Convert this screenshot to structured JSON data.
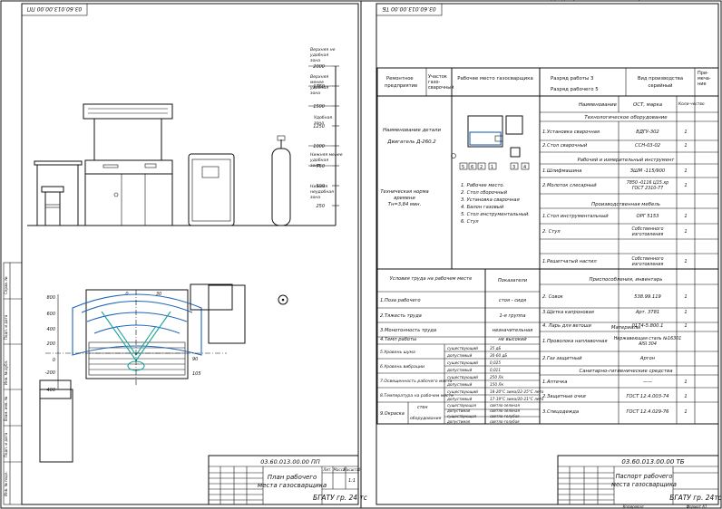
{
  "sheet_left": {
    "rotated_code": "03.60.013.00.00 ПП",
    "height_labels": [
      "2000",
      "1750",
      "1500",
      "1250",
      "1000",
      "750",
      "500",
      "250"
    ],
    "zones": [
      "Верхняя не удобная зона",
      "Верхняя менее удобная зона",
      "Удобная зона",
      "Нижняя менее удобная зона",
      "Нижняя неудобная зона"
    ],
    "plan_axis": [
      "800",
      "600",
      "400",
      "200",
      "0",
      "-200",
      "400"
    ],
    "plan_top": [
      "0",
      "30"
    ],
    "plan_right": [
      "90",
      "105"
    ],
    "title_code": "03.60.013.00.00 ПП",
    "title_name": "План рабочего места газосварщика",
    "title_org": "БГАТУ гр. 24 тс",
    "scale_hdr": [
      "Лит.",
      "Масса",
      "Масштаб"
    ],
    "scale_val": "1:1",
    "side_stamp": [
      "Инв. № подл.",
      "Подп. и дата",
      "Взам. инв. №",
      "Инв. № дубл.",
      "Подп. и дата",
      "Справ. №",
      "Перв. примен."
    ]
  },
  "sheet_right": {
    "rotated_code": "03.60.013.00.00 ТБ",
    "head": {
      "col1": "Ремонтное предприятие",
      "col2": "Участок газо-сварочный",
      "col3": "Рабочее место газосварщика",
      "col4a": "Разряд работы 3",
      "col4b": "Разряд рабочего 5",
      "col5": "Вид производства серийный",
      "col6": "При-меча-ние"
    },
    "part_name": "Наименование детали",
    "part_value": "Двигатель Д-260.2",
    "norm": "Техническая норма времени Тн=3,84 мин.",
    "legend": [
      "1. Рабочее место.",
      "2. Стол сборочный",
      "3. Установка сварочная",
      "4. Балон газовый",
      "5. Стол инструментальный.",
      "6. Стул"
    ],
    "sketch_labels": [
      "5",
      "6",
      "2",
      "1",
      "3",
      "4"
    ],
    "eq_hdr": [
      "Наименование",
      "ОСТ, марка",
      "Коли-чество"
    ],
    "sections": {
      "tech": "Технологическое оборудование",
      "tools": "Рабочий и измерительный инструмент",
      "furn": "Производственная мебель",
      "fixt": "Приспособления, инвентарь",
      "mat": "Материалы",
      "san": "Санитарно-гигиенические средства"
    },
    "tech_rows": [
      {
        "n": "1.Установка сварочная",
        "m": "ВДГУ-302",
        "q": "1"
      },
      {
        "n": "2.Стол сварочный",
        "m": "ССН-03-02",
        "q": "1"
      }
    ],
    "tool_rows": [
      {
        "n": "1.Шлифмашина",
        "m": "ЗШМ -115/900",
        "q": "1"
      },
      {
        "n": "2.Молоток слесарный",
        "m": "7850 -0116 Ц15.хр ГОСТ 2310-77",
        "q": "1"
      }
    ],
    "furn_rows": [
      {
        "n": "1.Стол инструментальный",
        "m": "ОРГ 5153",
        "q": "1"
      },
      {
        "n": "2. Стул",
        "m": "Собственного изготовления",
        "q": "1"
      }
    ],
    "fixt_rows": [
      {
        "n": "1.Решетчатый настил",
        "m": "Собственного изготовления",
        "q": "1"
      },
      {
        "n": "2. Совок",
        "m": "538.99.119",
        "q": "1"
      },
      {
        "n": "3.Щетка капроновая",
        "m": "Арт. 3781",
        "q": "1"
      },
      {
        "n": "4. Ларь для ветоши",
        "m": "0174-5.800.1",
        "q": "1"
      }
    ],
    "mat_rows": [
      {
        "n": "1.Проволока наплавочная",
        "m": "Нержавеющая сталь №16301 AISI 304",
        "q": ""
      },
      {
        "n": "2.Газ защитный",
        "m": "Аргон",
        "q": ""
      }
    ],
    "san_rows": [
      {
        "n": "1.Аптечка",
        "m": "——",
        "q": "1"
      },
      {
        "n": "2.Защитные очки",
        "m": "ГОСТ 12.4.003-74",
        "q": "1"
      },
      {
        "n": "3.Спецодежда",
        "m": "ГОСТ 12.4.029-76",
        "q": "1"
      }
    ],
    "cond_hdr": [
      "Условия труда на рабочем месте",
      "Показатели"
    ],
    "cond_rows": [
      {
        "n": "1.Поза рабочего",
        "v": "стоя - сидя"
      },
      {
        "n": "2.Тяжесть труда",
        "v": "1-я группа"
      },
      {
        "n": "3.Монотонность труда",
        "v": "незначительная"
      },
      {
        "n": "4.Темп работы",
        "v": "не высокий"
      }
    ],
    "cond_pairs": [
      {
        "n": "5.Уровень шума",
        "a": "существующий",
        "av": "35 дБ",
        "b": "допустимый",
        "bv": "30-60 дБ"
      },
      {
        "n": "6.Уровень вибрации",
        "a": "существующий",
        "av": "0,025",
        "b": "допустимый",
        "bv": "0,011"
      },
      {
        "n": "7.Освещенность рабочего места",
        "a": "существующий",
        "av": "250 Лк",
        "b": "допустимый",
        "bv": "150 Лк"
      },
      {
        "n": "8.Температура на рабочем месте",
        "a": "существующий",
        "av": "18-20°С зима/22-25°С лето",
        "b": "допустимый",
        "bv": "17-19°С зима/20-21°С лето"
      }
    ],
    "paint": {
      "n": "9.Окраска",
      "w": "стен",
      "f": "оборудования",
      "rows": [
        "существующая",
        "светло-зеленая",
        "допустимая",
        "светло-зеленая",
        "существующая",
        "светло-голубая",
        "допустимая",
        "светло-голубая"
      ]
    },
    "title_code": "03.60.013.00.00 ТБ",
    "title_name": "Паспорт рабочего места газосварщика",
    "title_org": "БГАТУ гр. 24тс",
    "bottom_labels": [
      "Копировал",
      "Формат А1"
    ]
  }
}
